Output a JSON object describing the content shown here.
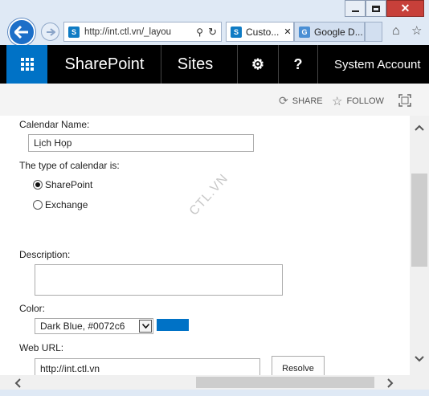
{
  "browser": {
    "url": "http://int.ctl.vn/_layou",
    "tabs": [
      {
        "label": "Custo..."
      },
      {
        "label": "Google D..."
      }
    ]
  },
  "suite": {
    "brand": "SharePoint",
    "sites": "Sites",
    "user": "System Account"
  },
  "ribbon": {
    "share": "SHARE",
    "follow": "FOLLOW"
  },
  "form": {
    "calendar_name_label": "Calendar Name:",
    "calendar_name_value": "Lịch Họp",
    "type_label": "The type of calendar is:",
    "type_options": [
      {
        "label": "SharePoint",
        "selected": true
      },
      {
        "label": "Exchange",
        "selected": false
      }
    ],
    "description_label": "Description:",
    "description_value": "",
    "color_label": "Color:",
    "color_selected": "Dark Blue, #0072c6",
    "color_swatch": "#0072c6",
    "web_url_label": "Web URL:",
    "web_url_value": "http://int.ctl.vn",
    "resolve_label": "Resolve"
  },
  "watermark": "CTL.VN"
}
